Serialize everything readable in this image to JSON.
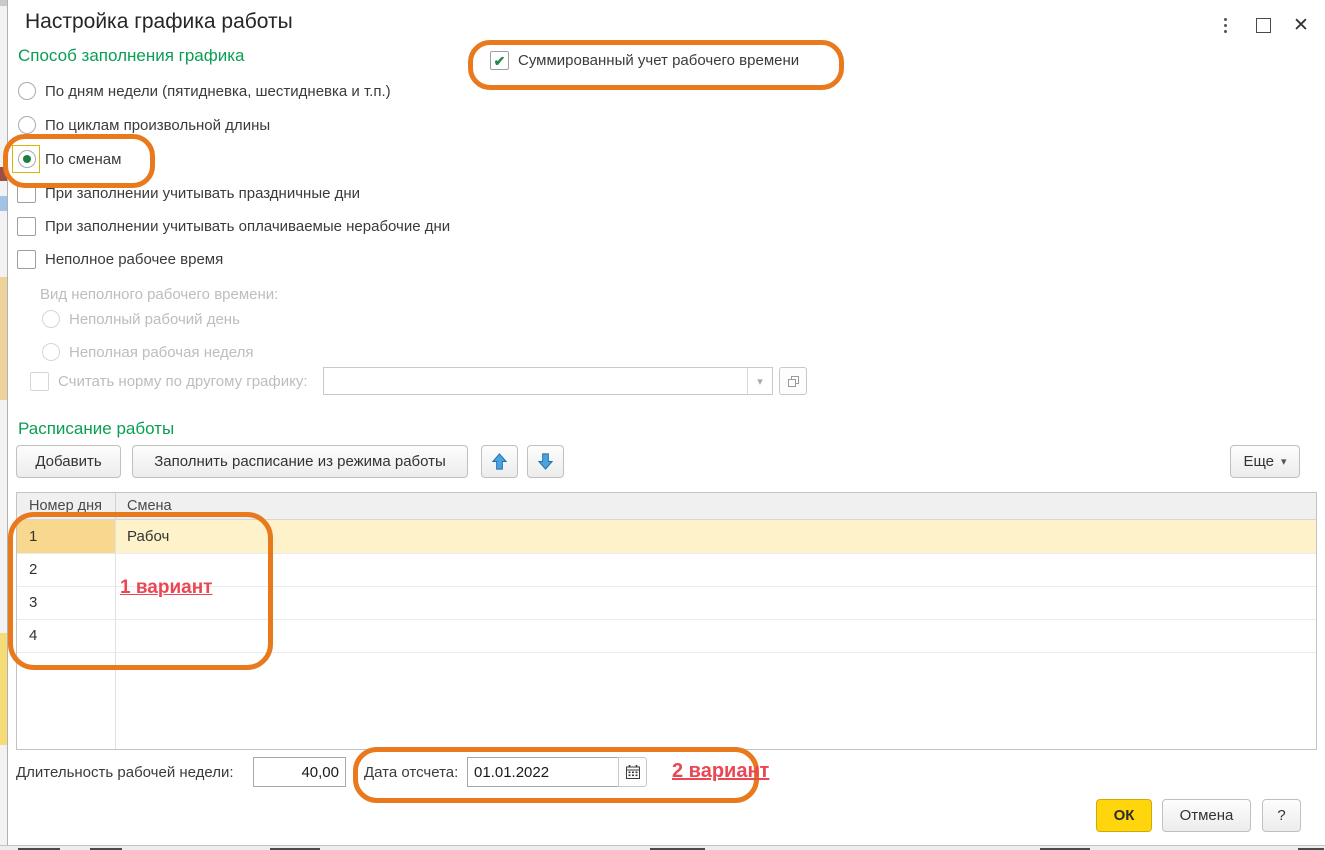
{
  "window": {
    "title": "Настройка графика работы"
  },
  "icons": {
    "dropdown_arrow": "▾",
    "checkmark": "✔",
    "close": "✕"
  },
  "method_section": {
    "heading": "Способ заполнения графика",
    "options": [
      {
        "label": "По дням недели (пятидневка, шестидневка и т.п.)",
        "selected": false
      },
      {
        "label": "По циклам произвольной длины",
        "selected": false
      },
      {
        "label": "По сменам",
        "selected": true
      }
    ]
  },
  "summed_time": {
    "label": "Суммированный учет рабочего времени",
    "checked": true
  },
  "fill_options": [
    {
      "label": "При заполнении учитывать праздничные дни",
      "checked": false
    },
    {
      "label": "При заполнении учитывать оплачиваемые нерабочие дни",
      "checked": false
    }
  ],
  "part_time": {
    "toggle_label": "Неполное рабочее время",
    "toggle_checked": false,
    "kind_label": "Вид неполного рабочего времени:",
    "options": [
      {
        "label": "Неполный рабочий день",
        "selected": false
      },
      {
        "label": "Неполная рабочая неделя",
        "selected": false
      }
    ],
    "other_schedule_label": "Считать норму по другому графику:",
    "other_schedule_value": ""
  },
  "schedule_section": {
    "heading": "Расписание работы",
    "add_button": "Добавить",
    "fill_button": "Заполнить расписание из режима работы",
    "more_button": "Еще",
    "table": {
      "columns": [
        "Номер дня",
        "Смена"
      ],
      "rows": [
        {
          "day": "1",
          "shift": "Рабоч",
          "selected": true
        },
        {
          "day": "2",
          "shift": "",
          "selected": false
        },
        {
          "day": "3",
          "shift": "",
          "selected": false
        },
        {
          "day": "4",
          "shift": "",
          "selected": false
        }
      ]
    }
  },
  "footer": {
    "week_length_label": "Длительность рабочей недели:",
    "week_length_value": "40,00",
    "start_date_label": "Дата отсчета:",
    "start_date_value": "01.01.2022",
    "ok_button": "ОК",
    "cancel_button": "Отмена",
    "help_button": "?"
  },
  "annotations": {
    "variant_1": "1 вариант",
    "variant_2": "2 вариант",
    "highlight_color": "#e8791c",
    "text_color": "#ea4653"
  },
  "colors": {
    "heading_green": "#0a9e52",
    "check_green": "#1f8b45",
    "selected_row": "#fdf2ca",
    "selected_cell": "#f7d88e",
    "ok_yellow": "#ffd60b",
    "arrow_blue": "#4aa3e0"
  }
}
